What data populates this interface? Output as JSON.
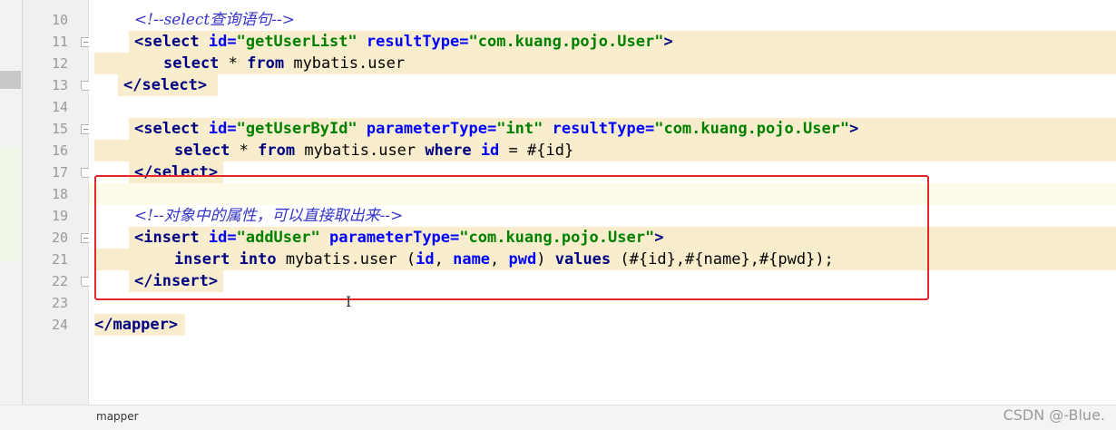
{
  "editor": {
    "lines": [
      {
        "number": "10",
        "tokens": [
          {
            "cls": "cmt",
            "text": "<!--select查询语句-->"
          }
        ]
      },
      {
        "number": "11",
        "tokens": [
          {
            "cls": "tag",
            "text": "<select "
          },
          {
            "cls": "attr",
            "text": "id="
          },
          {
            "cls": "val",
            "text": "\"getUserList\" "
          },
          {
            "cls": "attr",
            "text": "resultType="
          },
          {
            "cls": "val",
            "text": "\"com.kuang.pojo.User\""
          },
          {
            "cls": "tag",
            "text": ">"
          }
        ]
      },
      {
        "number": "12",
        "tokens": [
          {
            "cls": "kw",
            "text": "select "
          },
          {
            "cls": "txt",
            "text": "* "
          },
          {
            "cls": "kw",
            "text": "from "
          },
          {
            "cls": "txt",
            "text": "mybatis.user"
          }
        ]
      },
      {
        "number": "13",
        "tokens": [
          {
            "cls": "tag",
            "text": "</select>"
          }
        ]
      },
      {
        "number": "14",
        "tokens": []
      },
      {
        "number": "15",
        "tokens": [
          {
            "cls": "tag",
            "text": "<select "
          },
          {
            "cls": "attr",
            "text": "id="
          },
          {
            "cls": "val",
            "text": "\"getUserById\" "
          },
          {
            "cls": "attr",
            "text": "parameterType="
          },
          {
            "cls": "val",
            "text": "\"int\" "
          },
          {
            "cls": "attr",
            "text": "resultType="
          },
          {
            "cls": "val",
            "text": "\"com.kuang.pojo.User\""
          },
          {
            "cls": "tag",
            "text": ">"
          }
        ]
      },
      {
        "number": "16",
        "tokens": [
          {
            "cls": "kw",
            "text": "select "
          },
          {
            "cls": "txt",
            "text": "* "
          },
          {
            "cls": "kw",
            "text": "from "
          },
          {
            "cls": "txt",
            "text": "mybatis.user "
          },
          {
            "cls": "kw",
            "text": "where "
          },
          {
            "cls": "attr",
            "text": "id"
          },
          {
            "cls": "txt",
            "text": " = #{id}"
          }
        ]
      },
      {
        "number": "17",
        "tokens": [
          {
            "cls": "tag",
            "text": "</select>"
          }
        ]
      },
      {
        "number": "18",
        "tokens": []
      },
      {
        "number": "19",
        "tokens": [
          {
            "cls": "cmt",
            "text": "<!--对象中的属性，可以直接取出来-->"
          }
        ]
      },
      {
        "number": "20",
        "tokens": [
          {
            "cls": "tag",
            "text": "<insert "
          },
          {
            "cls": "attr",
            "text": "id="
          },
          {
            "cls": "val",
            "text": "\"addUser\" "
          },
          {
            "cls": "attr",
            "text": "parameterType="
          },
          {
            "cls": "val",
            "text": "\"com.kuang.pojo.User\""
          },
          {
            "cls": "tag",
            "text": ">"
          }
        ]
      },
      {
        "number": "21",
        "tokens": [
          {
            "cls": "kw",
            "text": "insert into "
          },
          {
            "cls": "txt",
            "text": "mybatis.user ("
          },
          {
            "cls": "attr",
            "text": "id"
          },
          {
            "cls": "txt",
            "text": ", "
          },
          {
            "cls": "attr",
            "text": "name"
          },
          {
            "cls": "txt",
            "text": ", "
          },
          {
            "cls": "attr",
            "text": "pwd"
          },
          {
            "cls": "txt",
            "text": ") "
          },
          {
            "cls": "kw",
            "text": "values "
          },
          {
            "cls": "txt",
            "text": "(#{id},#{name},#{pwd});"
          }
        ]
      },
      {
        "number": "22",
        "tokens": [
          {
            "cls": "tag",
            "text": "</insert>"
          }
        ]
      },
      {
        "number": "23",
        "tokens": []
      },
      {
        "number": "24",
        "tokens": [
          {
            "cls": "tag",
            "text": "</mapper>"
          }
        ]
      }
    ]
  },
  "breadcrumb": {
    "label": "mapper"
  },
  "watermark": {
    "text": "CSDN @-Blue."
  }
}
